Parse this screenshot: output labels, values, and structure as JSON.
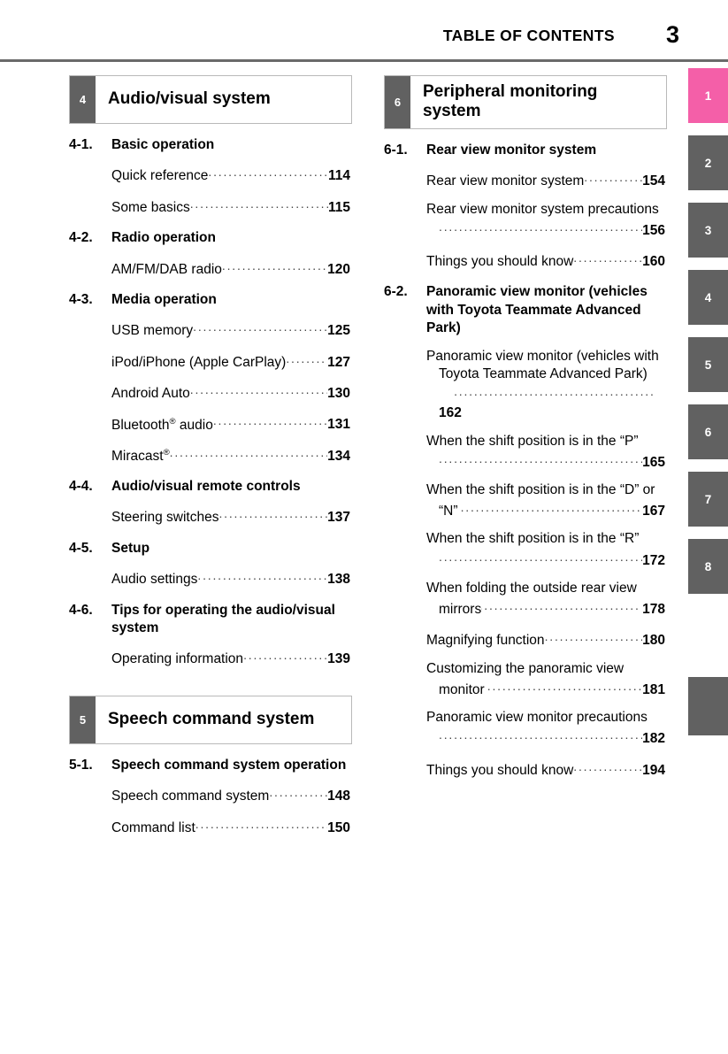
{
  "header": {
    "title": "TABLE OF CONTENTS",
    "page_number": "3"
  },
  "colors": {
    "accent_pink": "#ee6fb0",
    "tab_active_pink": "#f45fa8",
    "tab_gray": "#616161",
    "rule_gray": "#6a6a6a"
  },
  "index_tabs": [
    {
      "label": "1",
      "active": true
    },
    {
      "label": "2",
      "active": false
    },
    {
      "label": "3",
      "active": false
    },
    {
      "label": "4",
      "active": false
    },
    {
      "label": "5",
      "active": false
    },
    {
      "label": "6",
      "active": false
    },
    {
      "label": "7",
      "active": false
    },
    {
      "label": "8",
      "active": false
    },
    {
      "label": "",
      "active": false
    }
  ],
  "left_column": {
    "chapter_4": {
      "number": "4",
      "title": "Audio/visual system"
    },
    "sections": [
      {
        "number": "4-1.",
        "label": "Basic operation",
        "entries": [
          {
            "text": "Quick reference",
            "page": "114"
          },
          {
            "text": "Some basics",
            "page": "115"
          }
        ]
      },
      {
        "number": "4-2.",
        "label": "Radio operation",
        "entries": [
          {
            "text": "AM/FM/DAB radio",
            "page": "120"
          }
        ]
      },
      {
        "number": "4-3.",
        "label": "Media operation",
        "entries": [
          {
            "text": "USB memory",
            "page": "125"
          },
          {
            "text": "iPod/iPhone (Apple CarPlay)",
            "page": "127"
          },
          {
            "text": "Android Auto",
            "page": "130"
          },
          {
            "text": "Bluetooth® audio",
            "page": "131"
          },
          {
            "text": "Miracast®",
            "page": "134"
          }
        ]
      },
      {
        "number": "4-4.",
        "label": "Audio/visual remote controls",
        "entries": [
          {
            "text": "Steering switches",
            "page": "137"
          }
        ]
      },
      {
        "number": "4-5.",
        "label": "Setup",
        "entries": [
          {
            "text": "Audio settings",
            "page": "138"
          }
        ]
      },
      {
        "number": "4-6.",
        "label": "Tips for operating the audio/visual system",
        "entries": [
          {
            "text": "Operating information",
            "page": "139"
          }
        ]
      }
    ],
    "chapter_5": {
      "number": "5",
      "title": "Speech command system"
    },
    "sections_5": [
      {
        "number": "5-1.",
        "label": "Speech command system operation",
        "entries": [
          {
            "text": "Speech command system",
            "page": "148"
          },
          {
            "text": "Command list",
            "page": "150"
          }
        ]
      }
    ]
  },
  "right_column": {
    "chapter_6": {
      "number": "6",
      "title": "Peripheral monitoring system"
    },
    "sections": [
      {
        "number": "6-1.",
        "label": "Rear view monitor system",
        "entries": [
          {
            "text": "Rear view monitor system",
            "page": "154"
          },
          {
            "text": "Rear view monitor system precautions",
            "page": "156"
          },
          {
            "text": "Things you should know",
            "page": "160"
          }
        ]
      },
      {
        "number": "6-2.",
        "label": "Panoramic view monitor (vehicles with Toyota Teammate Advanced Park)",
        "entries": [
          {
            "text": "Panoramic view monitor (vehicles with Toyota Teammate Advanced Park)",
            "page": "162"
          },
          {
            "text": "When the shift position is in the “P”",
            "page": "165"
          },
          {
            "text": "When the shift position is in the “D” or “N”",
            "page": "167"
          },
          {
            "text": "When the shift position is in the “R”",
            "page": "172"
          },
          {
            "text": "When folding the outside rear view mirrors",
            "page": "178"
          },
          {
            "text": "Magnifying function",
            "page": "180"
          },
          {
            "text": "Customizing the panoramic view monitor",
            "page": "181"
          },
          {
            "text": "Panoramic view monitor precautions",
            "page": "182"
          },
          {
            "text": "Things you should know",
            "page": "194"
          }
        ]
      }
    ]
  }
}
